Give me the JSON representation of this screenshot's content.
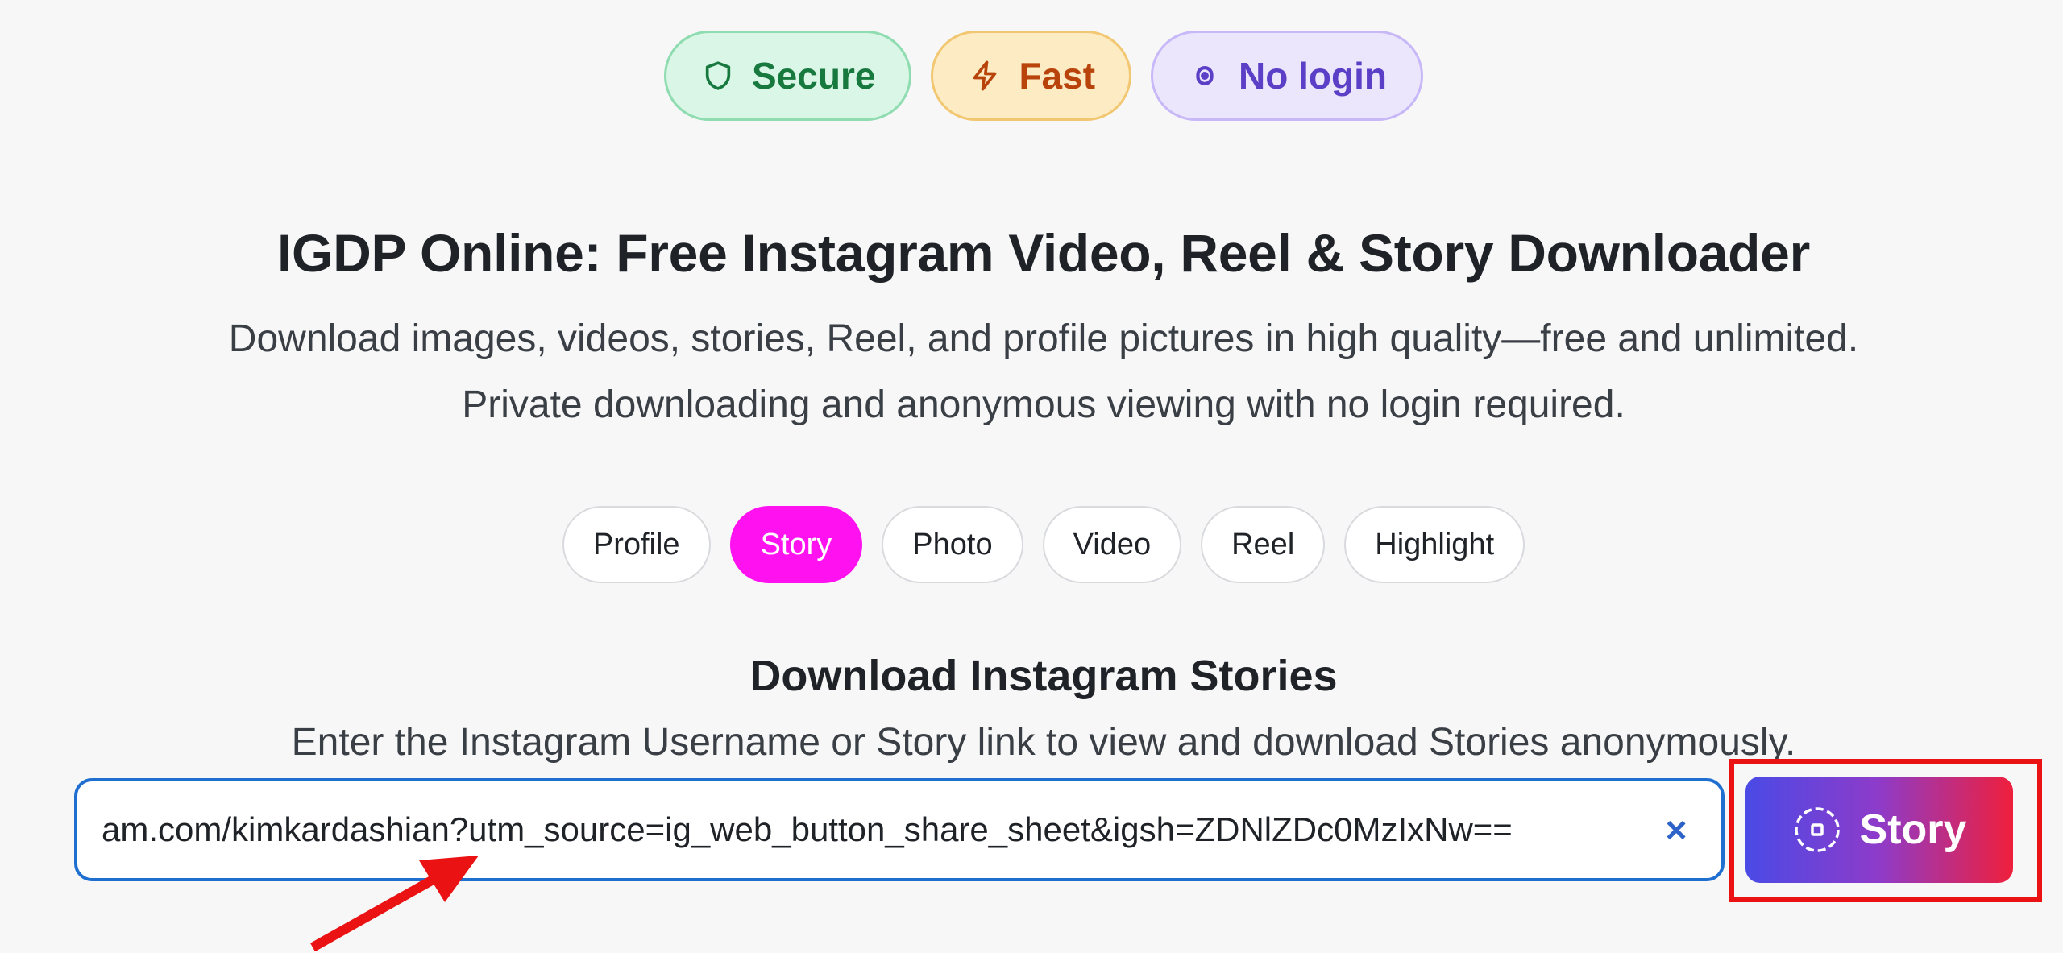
{
  "badges": [
    {
      "label": "Secure",
      "icon": "shield-icon",
      "color": "#18793f"
    },
    {
      "label": "Fast",
      "icon": "lightning-icon",
      "color": "#b8430b"
    },
    {
      "label": "No login",
      "icon": "lock-icon",
      "color": "#5b3fc6"
    }
  ],
  "hero": {
    "title": "IGDP Online: Free Instagram Video, Reel & Story Downloader",
    "subtitle_line1": "Download images, videos, stories, Reel, and profile pictures in high quality—free and unlimited.",
    "subtitle_line2": "Private downloading and anonymous viewing with no login required."
  },
  "tabs": [
    {
      "label": "Profile",
      "active": false
    },
    {
      "label": "Story",
      "active": true
    },
    {
      "label": "Photo",
      "active": false
    },
    {
      "label": "Video",
      "active": false
    },
    {
      "label": "Reel",
      "active": false
    },
    {
      "label": "Highlight",
      "active": false
    }
  ],
  "section": {
    "title": "Download Instagram Stories",
    "subtitle": "Enter the Instagram Username or Story link to view and download Stories anonymously."
  },
  "search": {
    "value": "am.com/kimkardashian?utm_source=ig_web_button_share_sheet&igsh=ZDNlZDc0MzIxNw==",
    "clear_label": "×"
  },
  "submit": {
    "label": "Story",
    "icon": "story-ring-icon"
  },
  "colors": {
    "active_tab": "#ff12ef",
    "input_border": "#1f6fd1",
    "highlight_box": "#ea1212",
    "arrow": "#ea1212"
  }
}
